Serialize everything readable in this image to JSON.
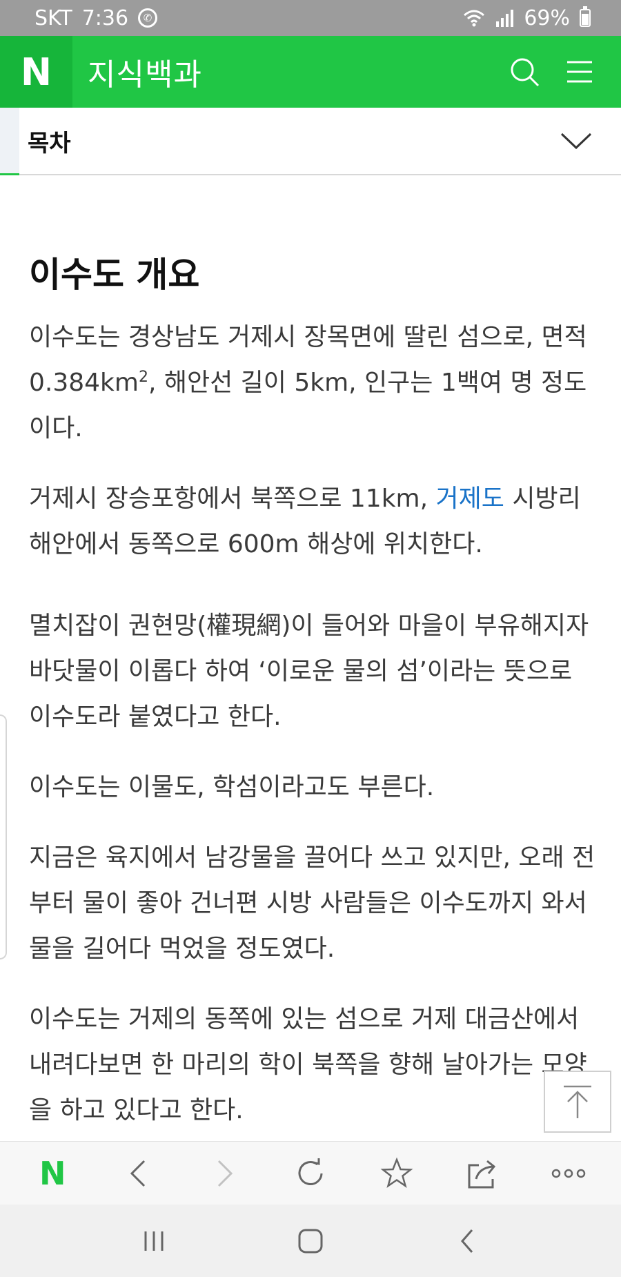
{
  "status_bar": {
    "carrier": "SKT",
    "time": "7:36",
    "battery": "69%"
  },
  "header": {
    "logo": "N",
    "title": "지식백과"
  },
  "toc": {
    "label": "목차"
  },
  "article": {
    "heading": "이수도 개요",
    "p1_before_sup": "이수도는 경상남도 거제시 장목면에 딸린 섬으로, 면적 0.384km",
    "p1_sup": "2",
    "p1_after_sup": ", 해안선 길이 5km, 인구는 1백여 명 정도이다.",
    "p2_before_link": "거제시 장승포항에서 북쪽으로 11km, ",
    "p2_link": "거제도",
    "p2_after_link": " 시방리 해안에서 동쪽으로 600m 해상에 위치한다.",
    "p3": "멸치잡이 권현망(權現網)이 들어와 마을이 부유해지자 바닷물이 이롭다 하여 ‘이로운 물의 섬’이라는 뜻으로 이수도라 붙였다고 한다.",
    "p4": "이수도는 이물도, 학섬이라고도 부른다.",
    "p5": "지금은 육지에서 남강물을 끌어다 쓰고 있지만, 오래 전부터 물이 좋아 건너편 시방 사람들은 이수도까지 와서 물을 길어다 먹었을 정도였다.",
    "p6": "이수도는 거제의 동쪽에 있는 섬으로 거제 대금산에서 내려다보면 한 마리의 학이 북쪽을 향해 날아가는 모양을 하고 있다고 한다."
  },
  "toolbar": {
    "logo": "N"
  },
  "icons": {
    "header": [
      "search-icon",
      "menu-icon"
    ],
    "toc": "chevron-down-icon",
    "floating": "arrow-up-to-top-icon",
    "toolbar": [
      "naver-logo-icon",
      "back-icon",
      "forward-icon",
      "refresh-icon",
      "star-icon",
      "share-icon",
      "more-icon"
    ],
    "nav": [
      "recents-icon",
      "home-icon",
      "back-icon"
    ]
  },
  "colors": {
    "brand_green": "#20c645",
    "link_blue": "#1a73c8",
    "status_bar": "#9c9c9c"
  }
}
